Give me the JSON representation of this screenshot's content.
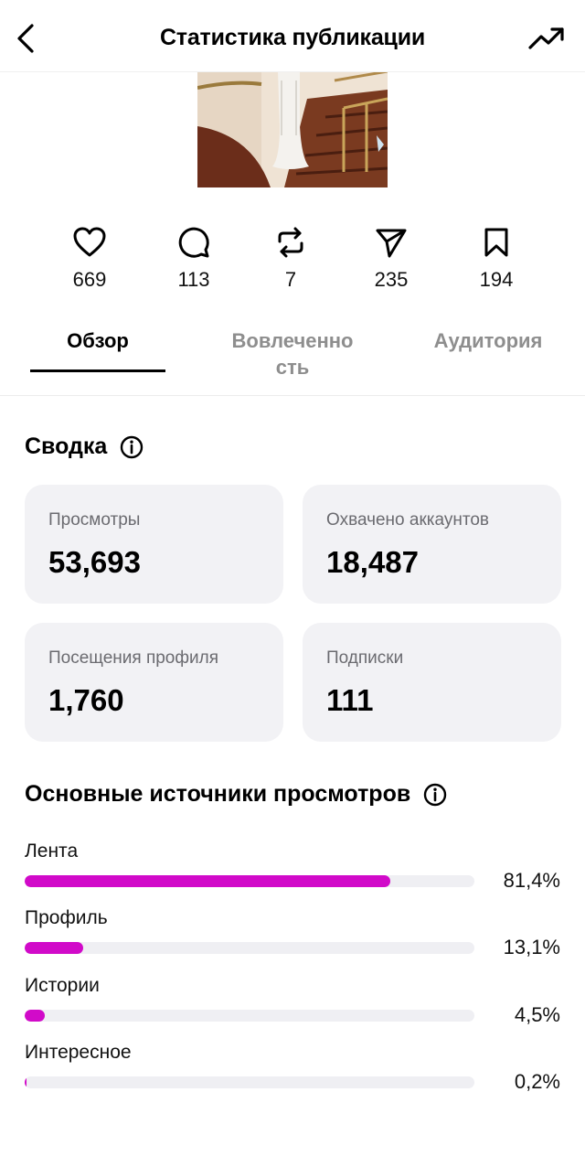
{
  "header": {
    "title": "Статистика публикации",
    "back_icon": "chevron-left-icon",
    "trend_icon": "trending-up-icon"
  },
  "post_stats": [
    {
      "icon": "heart-icon",
      "value": "669"
    },
    {
      "icon": "comment-icon",
      "value": "113"
    },
    {
      "icon": "repost-icon",
      "value": "7"
    },
    {
      "icon": "send-icon",
      "value": "235"
    },
    {
      "icon": "bookmark-icon",
      "value": "194"
    }
  ],
  "tabs": [
    {
      "label": "Обзор",
      "active": true
    },
    {
      "label": "Вовлеченно\nсть",
      "active": false
    },
    {
      "label": "Аудитория",
      "active": false
    }
  ],
  "summary": {
    "title": "Сводка",
    "cards": [
      {
        "label": "Просмотры",
        "value": "53,693"
      },
      {
        "label": "Охвачено аккаунтов",
        "value": "18,487"
      },
      {
        "label": "Посещения профиля",
        "value": "1,760"
      },
      {
        "label": "Подписки",
        "value": "111"
      }
    ]
  },
  "sources": {
    "title": "Основные источники просмотров",
    "accent_color": "#d10ac9",
    "items": [
      {
        "name": "Лента",
        "percent_label": "81,4%",
        "share": 0.814
      },
      {
        "name": "Профиль",
        "percent_label": "13,1%",
        "share": 0.131
      },
      {
        "name": "Истории",
        "percent_label": "4,5%",
        "share": 0.045
      },
      {
        "name": "Интересное",
        "percent_label": "0,2%",
        "share": 0.002
      }
    ]
  }
}
